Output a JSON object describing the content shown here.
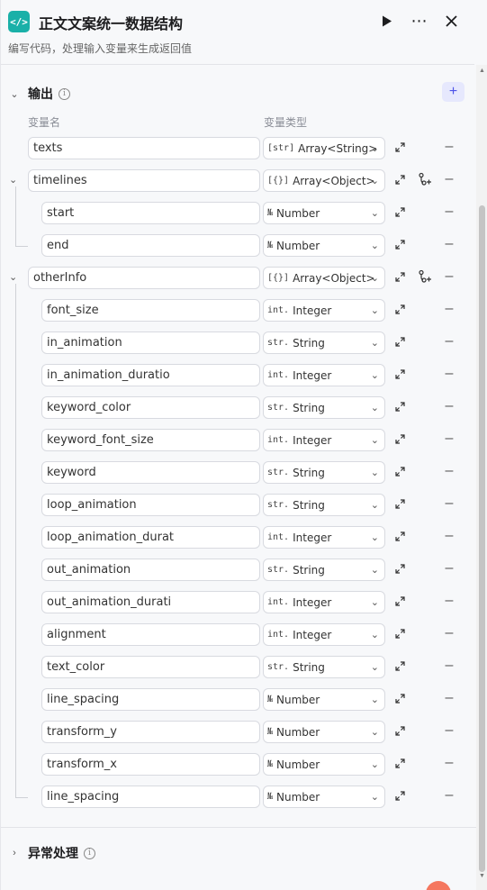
{
  "header": {
    "logo_glyph": "</>",
    "title": "正文文案统一数据结构",
    "subtitle": "编写代码，处理输入变量来生成返回值",
    "run_icon": "play-icon",
    "more_icon": "more-icon",
    "close_icon": "close-icon"
  },
  "output_section": {
    "title": "输出",
    "add_label": "+",
    "col_name": "变量名",
    "col_type": "变量类型"
  },
  "rows": [
    {
      "name": "texts",
      "type_icon": "[str]",
      "type": "Array<String>",
      "level": 0
    },
    {
      "name": "timelines",
      "type_icon": "[{}]",
      "type": "Array<Object>",
      "level": 0,
      "expandable": true
    },
    {
      "name": "start",
      "type_icon": "№",
      "type": "Number",
      "level": 1
    },
    {
      "name": "end",
      "type_icon": "№",
      "type": "Number",
      "level": 1
    },
    {
      "name": "otherInfo",
      "type_icon": "[{}]",
      "type": "Array<Object>",
      "level": 0,
      "expandable": true
    },
    {
      "name": "font_size",
      "type_icon": "int.",
      "type": "Integer",
      "level": 1
    },
    {
      "name": "in_animation",
      "type_icon": "str.",
      "type": "String",
      "level": 1
    },
    {
      "name": "in_animation_duratio",
      "type_icon": "int.",
      "type": "Integer",
      "level": 1
    },
    {
      "name": "keyword_color",
      "type_icon": "str.",
      "type": "String",
      "level": 1
    },
    {
      "name": "keyword_font_size",
      "type_icon": "int.",
      "type": "Integer",
      "level": 1
    },
    {
      "name": "keyword",
      "type_icon": "str.",
      "type": "String",
      "level": 1
    },
    {
      "name": "loop_animation",
      "type_icon": "str.",
      "type": "String",
      "level": 1
    },
    {
      "name": "loop_animation_durat",
      "type_icon": "int.",
      "type": "Integer",
      "level": 1
    },
    {
      "name": "out_animation",
      "type_icon": "str.",
      "type": "String",
      "level": 1
    },
    {
      "name": "out_animation_durati",
      "type_icon": "int.",
      "type": "Integer",
      "level": 1
    },
    {
      "name": "alignment",
      "type_icon": "int.",
      "type": "Integer",
      "level": 1
    },
    {
      "name": "text_color",
      "type_icon": "str.",
      "type": "String",
      "level": 1
    },
    {
      "name": "line_spacing",
      "type_icon": "№",
      "type": "Number",
      "level": 1
    },
    {
      "name": "transform_y",
      "type_icon": "№",
      "type": "Number",
      "level": 1
    },
    {
      "name": "transform_x",
      "type_icon": "№",
      "type": "Number",
      "level": 1
    },
    {
      "name": "line_spacing",
      "type_icon": "№",
      "type": "Number",
      "level": 1
    }
  ],
  "exception_section": {
    "title": "异常处理"
  },
  "colors": {
    "accent": "#4d53e8",
    "logo": "#1ab0a8",
    "fab": "#f5775f"
  }
}
